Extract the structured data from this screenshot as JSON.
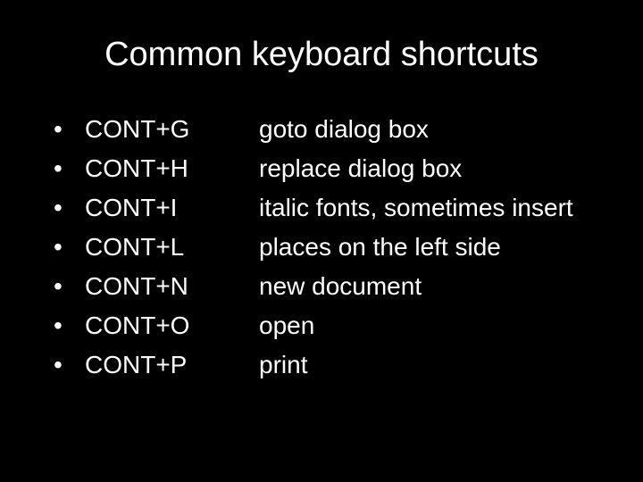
{
  "title": "Common keyboard shortcuts",
  "bullet": "•",
  "items": [
    {
      "shortcut": "CONT+G",
      "description": "goto dialog box"
    },
    {
      "shortcut": "CONT+H",
      "description": "replace dialog box"
    },
    {
      "shortcut": "CONT+I",
      "description": "italic fonts, sometimes insert"
    },
    {
      "shortcut": "CONT+L",
      "description": "places on the left side"
    },
    {
      "shortcut": "CONT+N",
      "description": "new document"
    },
    {
      "shortcut": "CONT+O",
      "description": "open"
    },
    {
      "shortcut": "CONT+P",
      "description": "print"
    }
  ]
}
